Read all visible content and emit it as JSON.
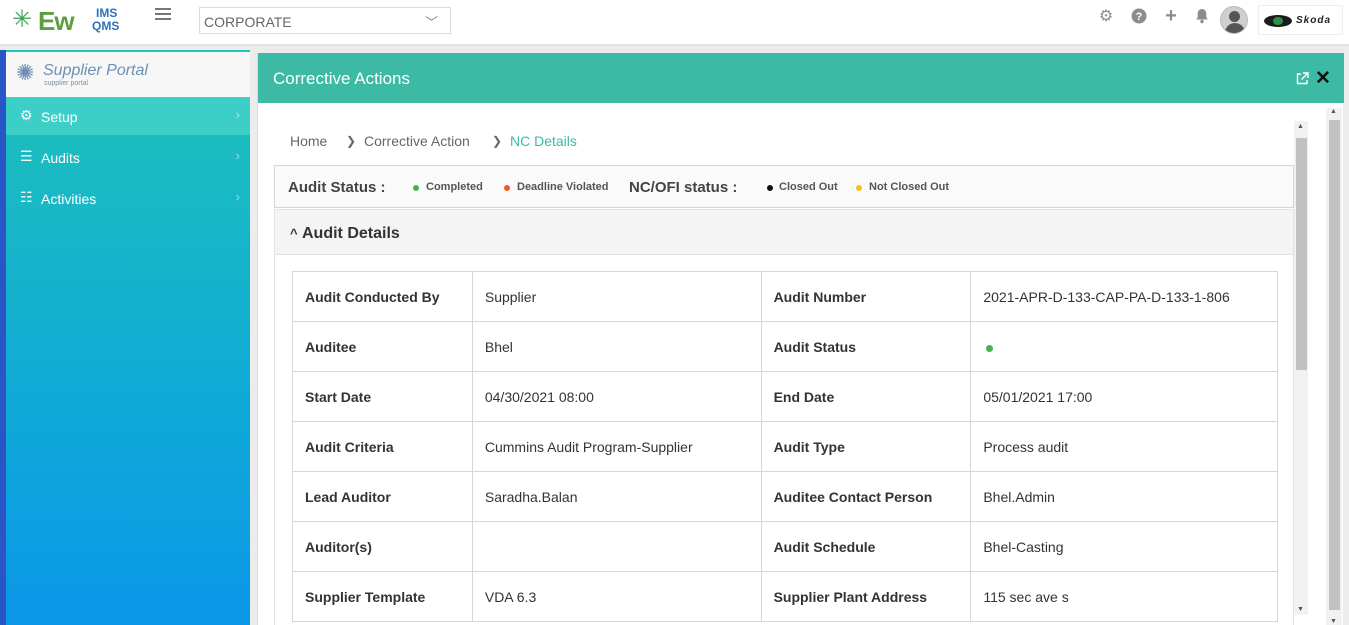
{
  "app": {
    "logo_main": "Ew",
    "logo_ims": "IMS",
    "logo_qms": "QMS",
    "org_select": {
      "value": "CORPORATE"
    },
    "top_icons": [
      "gear-icon",
      "help-icon",
      "plus-icon",
      "bell-icon"
    ],
    "brand_name": "Skoda"
  },
  "sidebar": {
    "title": "Supplier Portal",
    "subtitle": "supplier portal",
    "items": [
      {
        "label": "Setup",
        "icon": "gear-icon",
        "active": true
      },
      {
        "label": "Audits",
        "icon": "list-icon",
        "active": false
      },
      {
        "label": "Activities",
        "icon": "checklist-icon",
        "active": false
      }
    ]
  },
  "panel": {
    "title": "Corrective Actions",
    "breadcrumb": [
      "Home",
      "Corrective Action",
      "NC Details"
    ],
    "status_bar": {
      "audit_status_label": "Audit Status :",
      "audit_legend": [
        {
          "label": "Completed",
          "color": "#4caf50"
        },
        {
          "label": "Deadline Violated",
          "color": "#f05a28"
        }
      ],
      "nc_status_label": "NC/OFI status :",
      "nc_legend": [
        {
          "label": "Closed Out",
          "color": "#111111"
        },
        {
          "label": "Not Closed Out",
          "color": "#f2c21a"
        }
      ]
    },
    "section_title": "Audit Details",
    "details": [
      {
        "k1": "Audit Conducted By",
        "v1": "Supplier",
        "k2": "Audit Number",
        "v2": "2021-APR-D-133-CAP-PA-D-133-1-806"
      },
      {
        "k1": "Auditee",
        "v1": "Bhel",
        "k2": "Audit Status",
        "v2": ""
      },
      {
        "k1": "Start Date",
        "v1": "04/30/2021 08:00",
        "k2": "End Date",
        "v2": "05/01/2021 17:00"
      },
      {
        "k1": "Audit Criteria",
        "v1": "Cummins Audit Program-Supplier",
        "k2": "Audit Type",
        "v2": "Process audit"
      },
      {
        "k1": "Lead Auditor",
        "v1": "Saradha.Balan",
        "k2": "Auditee Contact Person",
        "v2": "Bhel.Admin"
      },
      {
        "k1": "Auditor(s)",
        "v1": "",
        "k2": "Audit Schedule",
        "v2": "Bhel-Casting"
      },
      {
        "k1": "Supplier Template",
        "v1": "VDA 6.3",
        "k2": "Supplier Plant Address",
        "v2": "115 sec ave s"
      }
    ],
    "audit_status_color": "#4caf50"
  }
}
